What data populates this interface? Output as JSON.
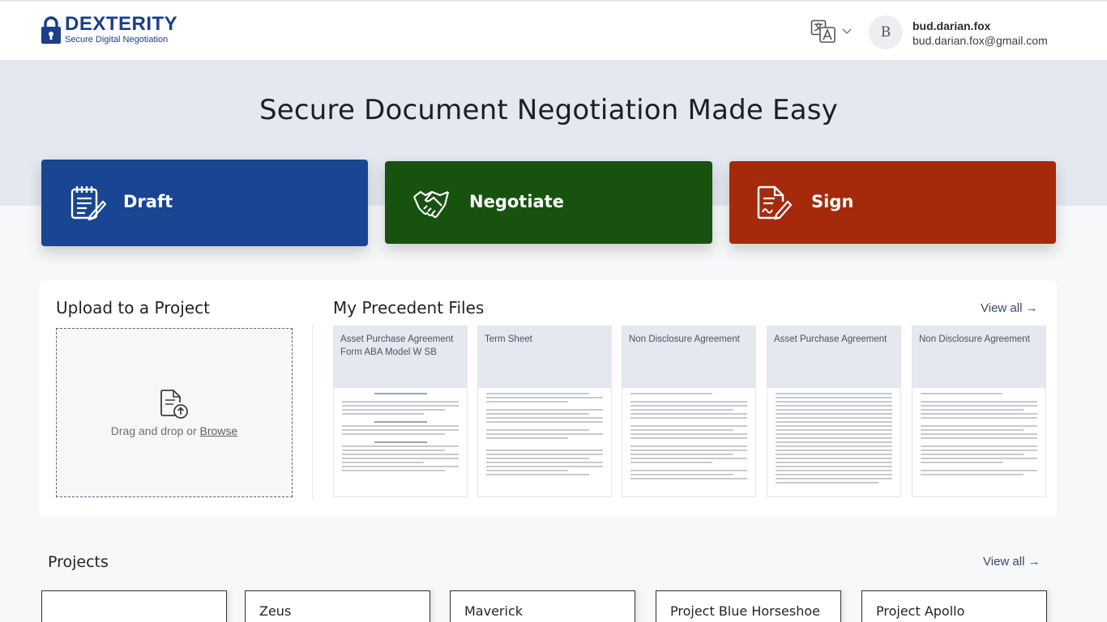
{
  "header": {
    "logo_title": "DEXTERITY",
    "logo_subtitle": "Secure Digital Negotiation",
    "language_icon": "translate-icon",
    "avatar_initial": "B",
    "user_name": "bud.darian.fox",
    "user_email": "bud.darian.fox@gmail.com"
  },
  "hero": {
    "title": "Secure Document Negotiation Made Easy"
  },
  "actions": [
    {
      "label": "Draft",
      "icon": "notepad-icon",
      "color": "#1a4592"
    },
    {
      "label": "Negotiate",
      "icon": "handshake-icon",
      "color": "#17530f"
    },
    {
      "label": "Sign",
      "icon": "signature-icon",
      "color": "#a52a0b"
    }
  ],
  "upload": {
    "title": "Upload to a Project",
    "drop_text": "Drag and drop or ",
    "browse_label": "Browse"
  },
  "precedents": {
    "title": "My Precedent Files",
    "view_all": "View all →",
    "files": [
      {
        "name": "Asset Purchase Agreement Form ABA Model W SB"
      },
      {
        "name": "Term Sheet"
      },
      {
        "name": "Non Disclosure Agreement"
      },
      {
        "name": "Asset Purchase Agreement"
      },
      {
        "name": "Non Disclosure Agreement"
      }
    ]
  },
  "projects": {
    "title": "Projects",
    "view_all": "View all →",
    "items": [
      {
        "name": ""
      },
      {
        "name": "Zeus"
      },
      {
        "name": "Maverick"
      },
      {
        "name": "Project Blue Horseshoe"
      },
      {
        "name": "Project Apollo"
      }
    ]
  }
}
